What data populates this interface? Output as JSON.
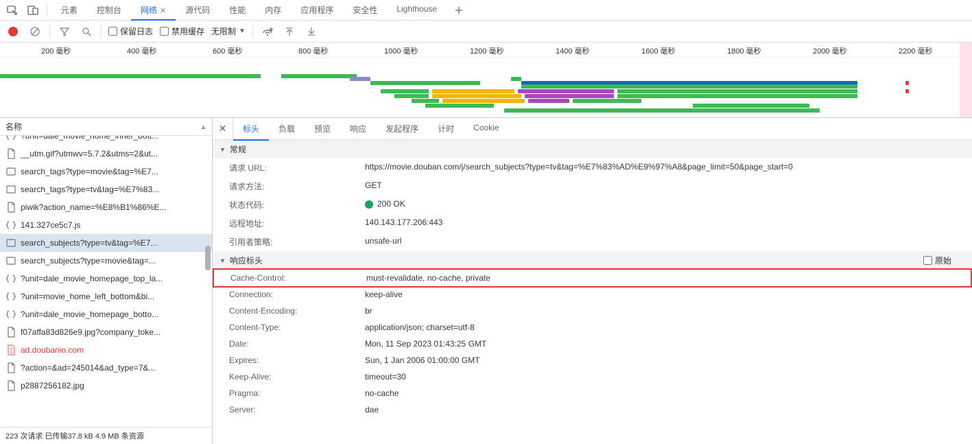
{
  "topTabs": {
    "items": [
      "元素",
      "控制台",
      "网络",
      "源代码",
      "性能",
      "内存",
      "应用程序",
      "安全性",
      "Lighthouse"
    ],
    "activeIdx": 2
  },
  "toolbar": {
    "preserveLog": "保留日志",
    "disableCache": "禁用缓存",
    "throttle": "无限制"
  },
  "timeline": {
    "ticks": [
      "200 毫秒",
      "400 毫秒",
      "600 毫秒",
      "800 毫秒",
      "1000 毫秒",
      "1200 毫秒",
      "1400 毫秒",
      "1600 毫秒",
      "1800 毫秒",
      "2000 毫秒",
      "2200 毫秒"
    ]
  },
  "sidebar": {
    "header": "名称",
    "rows": [
      {
        "icon": "bracket",
        "label": "?unit=dale_movie_home_inner_bott...",
        "clip": true
      },
      {
        "icon": "file",
        "label": "__utm.gif?utmwv=5.7.2&utms=2&ut..."
      },
      {
        "icon": "rect",
        "label": "search_tags?type=movie&tag=%E7..."
      },
      {
        "icon": "rect",
        "label": "search_tags?type=tv&tag=%E7%83..."
      },
      {
        "icon": "file",
        "label": "piwik?action_name=%E8%B1%86%E..."
      },
      {
        "icon": "bracket",
        "label": "141.327ce5c7.js"
      },
      {
        "icon": "rect",
        "label": "search_subjects?type=tv&tag=%E7...",
        "selected": true
      },
      {
        "icon": "rect",
        "label": "search_subjects?type=movie&tag=..."
      },
      {
        "icon": "bracket",
        "label": "?unit=dale_movie_homepage_top_la..."
      },
      {
        "icon": "bracket",
        "label": "?unit=movie_home_left_bottom&bi..."
      },
      {
        "icon": "bracket",
        "label": "?unit=dale_movie_homepage_botto..."
      },
      {
        "icon": "file",
        "label": "f07affa83d826e9.jpg?company_toke..."
      },
      {
        "icon": "doc",
        "label": "ad.doubanio.com",
        "red": true
      },
      {
        "icon": "file",
        "label": "?action=&ad=245014&ad_type=7&..."
      },
      {
        "icon": "file",
        "label": "p2887256182.jpg"
      }
    ],
    "footer": "223 次请求   已传输37.8 kB   4.9 MB 条资源"
  },
  "detailTabs": {
    "items": [
      "标头",
      "负载",
      "预览",
      "响应",
      "发起程序",
      "计时",
      "Cookie"
    ],
    "activeIdx": 0
  },
  "general": {
    "title": "常规",
    "rows": [
      {
        "k": "请求 URL:",
        "v": "https://movie.douban.com/j/search_subjects?type=tv&tag=%E7%83%AD%E9%97%A8&page_limit=50&page_start=0"
      },
      {
        "k": "请求方法:",
        "v": "GET"
      },
      {
        "k": "状态代码:",
        "v": "200 OK",
        "status": true
      },
      {
        "k": "远程地址:",
        "v": "140.143.177.206:443"
      },
      {
        "k": "引用者策略:",
        "v": "unsafe-url"
      }
    ]
  },
  "response": {
    "title": "响应标头",
    "raw": "原始",
    "rows": [
      {
        "k": "Cache-Control:",
        "v": "must-revalidate, no-cache, private",
        "hl": true
      },
      {
        "k": "Connection:",
        "v": "keep-alive"
      },
      {
        "k": "Content-Encoding:",
        "v": "br"
      },
      {
        "k": "Content-Type:",
        "v": "application/json; charset=utf-8"
      },
      {
        "k": "Date:",
        "v": "Mon, 11 Sep 2023 01:43:25 GMT"
      },
      {
        "k": "Expires:",
        "v": "Sun, 1 Jan 2006 01:00:00 GMT"
      },
      {
        "k": "Keep-Alive:",
        "v": "timeout=30"
      },
      {
        "k": "Pragma:",
        "v": "no-cache"
      },
      {
        "k": "Server:",
        "v": "dae"
      }
    ]
  }
}
